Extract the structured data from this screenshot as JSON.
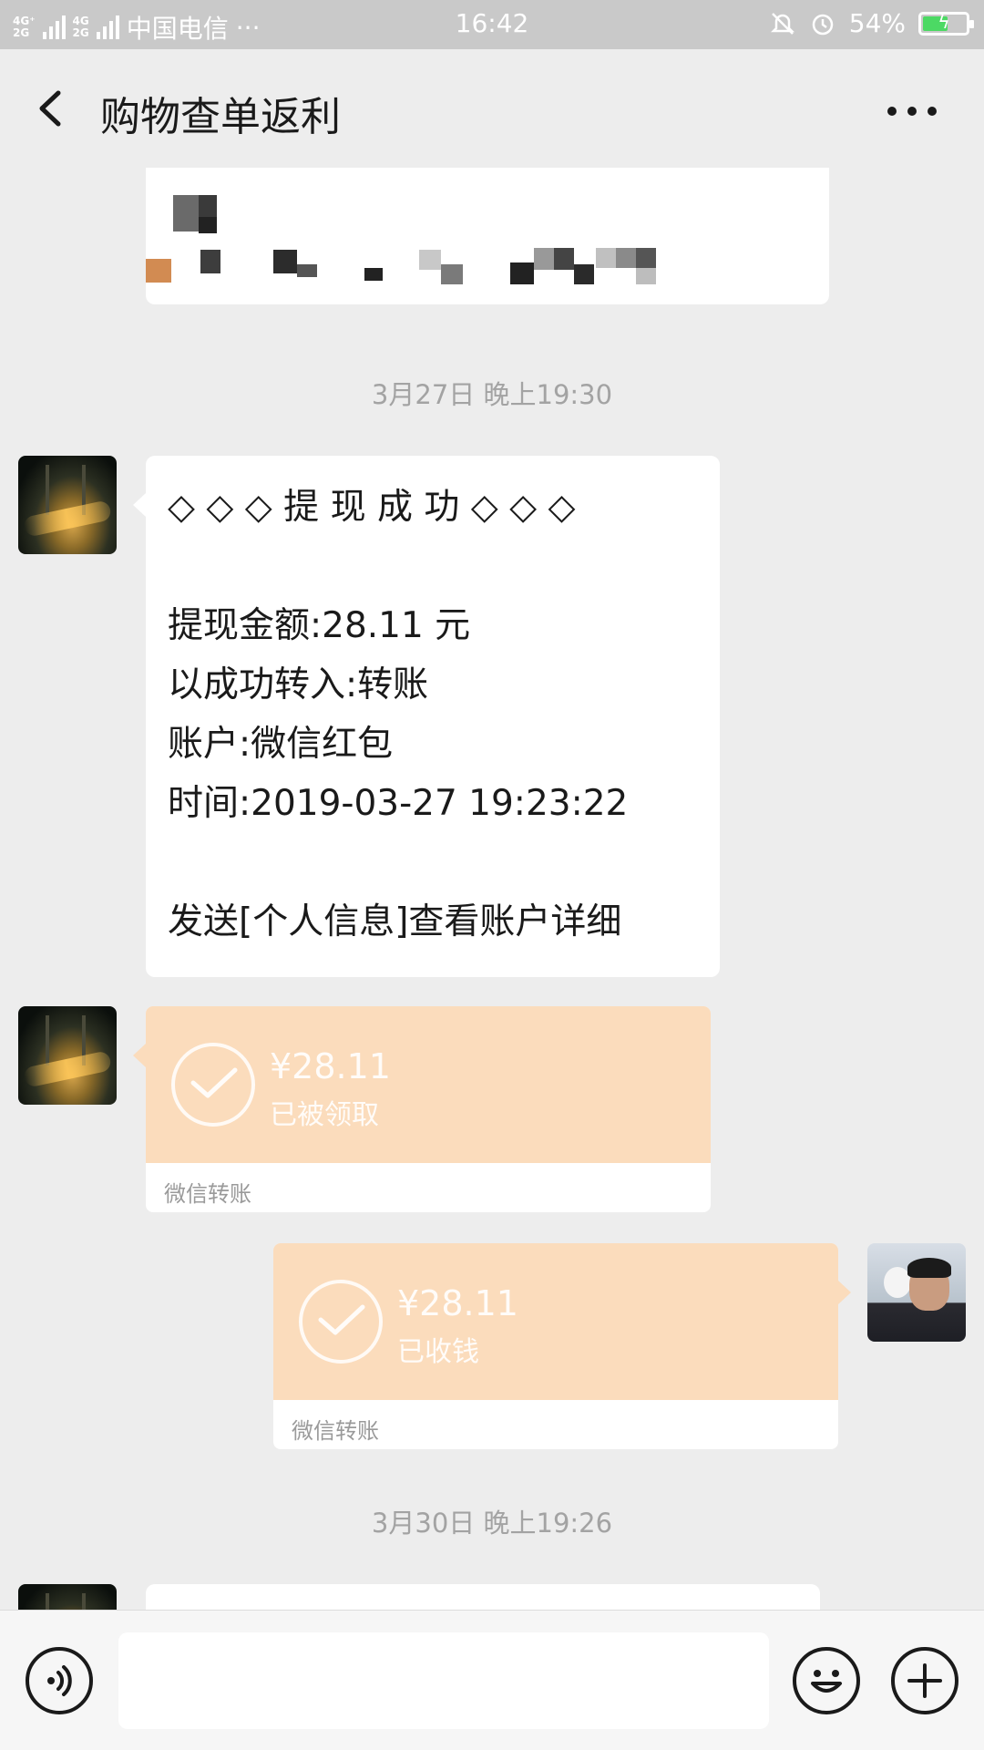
{
  "status_bar": {
    "network_top": "4G⁺",
    "network_bottom": "2G",
    "network_top2": "4G",
    "carrier": "中国电信",
    "carrier_dots": "···",
    "time": "16:42",
    "battery": "54%",
    "battery_level": 0.54
  },
  "header": {
    "title": "购物查单返利",
    "back_icon": "chevron-left-icon",
    "more_icon": "more-horizontal-icon"
  },
  "messages": {
    "timestamp_1": "3月27日 晚上19:30",
    "withdraw": {
      "line1": "◇ ◇ ◇ 提 现 成 功 ◇ ◇ ◇",
      "line2": "",
      "line3": "提现金额:28.11 元",
      "line4": "以成功转入:转账",
      "line5": "账户:微信红包",
      "line6": "时间:2019-03-27 19:23:22",
      "line7": "",
      "line8": "发送[个人信息]查看账户详细"
    },
    "transfer_1": {
      "amount": "¥28.11",
      "status": "已被领取",
      "footer": "微信转账"
    },
    "transfer_2": {
      "amount": "¥28.11",
      "status": "已收钱",
      "footer": "微信转账"
    },
    "timestamp_2": "3月30日 晚上19:26"
  },
  "input_bar": {
    "voice_icon": "voice-icon",
    "emoji_icon": "emoji-icon",
    "plus_icon": "plus-icon",
    "placeholder": ""
  },
  "colors": {
    "background": "#ededed",
    "bubble": "#ffffff",
    "transfer_card": "#fbdcbc",
    "timestamp": "#a3a3a3",
    "battery_fill": "#4cd964"
  }
}
